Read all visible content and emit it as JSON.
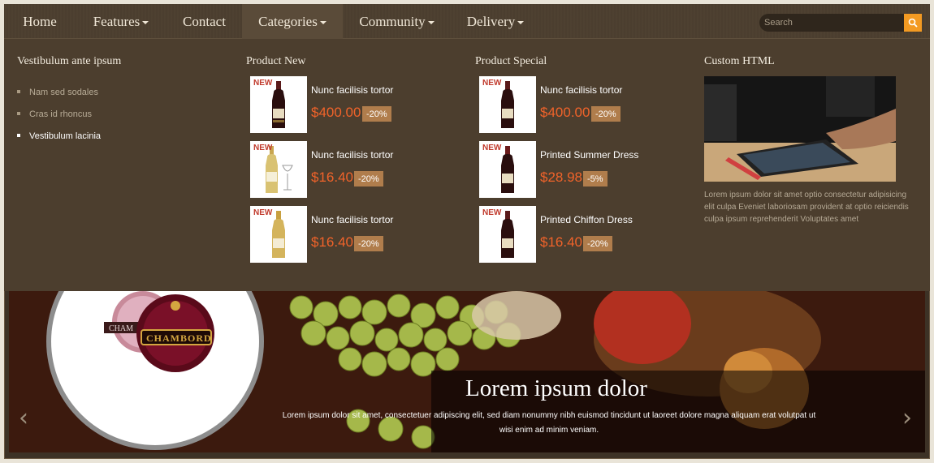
{
  "nav": {
    "items": [
      {
        "label": "Home",
        "has_caret": false
      },
      {
        "label": "Features",
        "has_caret": true
      },
      {
        "label": "Contact",
        "has_caret": false
      },
      {
        "label": "Categories",
        "has_caret": true,
        "active": true
      },
      {
        "label": "Community",
        "has_caret": true
      },
      {
        "label": "Delivery",
        "has_caret": true
      }
    ],
    "search_placeholder": "Search",
    "search_icon": "search-icon"
  },
  "mega": {
    "col1": {
      "title": "Vestibulum ante ipsum",
      "items": [
        "Nam sed sodales",
        "Cras id rhoncus",
        "Vestibulum lacinia"
      ]
    },
    "col2": {
      "title": "Product New",
      "products": [
        {
          "badge": "NEW",
          "name": "Nunc facilisis tortor",
          "price": "$400.00",
          "discount": "-20%"
        },
        {
          "badge": "NEW",
          "name": "Nunc facilisis tortor",
          "price": "$16.40",
          "discount": "-20%"
        },
        {
          "badge": "NEW",
          "name": "Nunc facilisis tortor",
          "price": "$16.40",
          "discount": "-20%"
        }
      ]
    },
    "col3": {
      "title": "Product Special",
      "products": [
        {
          "badge": "NEW",
          "name": "Nunc facilisis tortor",
          "price": "$400.00",
          "discount": "-20%"
        },
        {
          "badge": "NEW",
          "name": "Printed Summer Dress",
          "price": "$28.98",
          "discount": "-5%"
        },
        {
          "badge": "NEW",
          "name": "Printed Chiffon Dress",
          "price": "$16.40",
          "discount": "-20%"
        }
      ]
    },
    "col4": {
      "title": "Custom HTML",
      "text": "Lorem ipsum dolor sit amet optio consectetur adipisicing elit culpa Eveniet laboriosam provident at optio reiciendis culpa ipsum reprehenderit Voluptates amet"
    }
  },
  "slider": {
    "title": "Lorem ipsum dolor",
    "text": "Lorem ipsum dolor sit amet, consectetuer adipiscing elit, sed diam nonummy nibh euismod tincidunt ut laoreet dolore magna aliquam erat volutpat ut wisi enim ad minim veniam.",
    "bottle_label": "CHAMBORD",
    "bottle_label_partial": "CHAM",
    "prev_glyph": "‹",
    "next_glyph": "›"
  }
}
